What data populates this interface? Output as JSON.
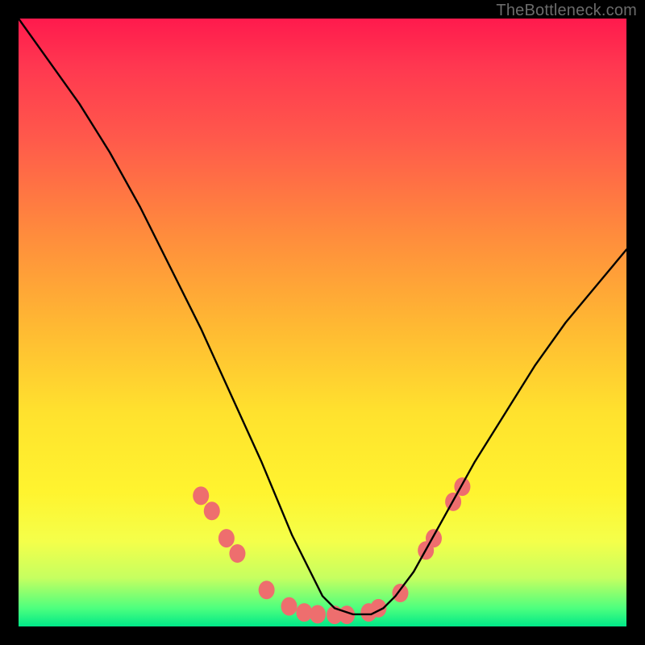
{
  "attribution": "TheBottleneck.com",
  "chart_data": {
    "type": "line",
    "title": "",
    "xlabel": "",
    "ylabel": "",
    "xlim": [
      0,
      100
    ],
    "ylim": [
      0,
      100
    ],
    "series": [
      {
        "name": "curve",
        "x": [
          0,
          5,
          10,
          15,
          20,
          25,
          30,
          35,
          40,
          45,
          48,
          50,
          52,
          55,
          58,
          60,
          62,
          65,
          70,
          75,
          80,
          85,
          90,
          95,
          100
        ],
        "y": [
          100,
          93,
          86,
          78,
          69,
          59,
          49,
          38,
          27,
          15,
          9,
          5,
          3,
          2,
          2,
          3,
          5,
          9,
          18,
          27,
          35,
          43,
          50,
          56,
          62
        ]
      }
    ],
    "markers": [
      {
        "x": 30.0,
        "y": 21.5
      },
      {
        "x": 31.8,
        "y": 19.0
      },
      {
        "x": 34.2,
        "y": 14.5
      },
      {
        "x": 36.0,
        "y": 12.0
      },
      {
        "x": 40.8,
        "y": 6.0
      },
      {
        "x": 44.5,
        "y": 3.3
      },
      {
        "x": 47.0,
        "y": 2.3
      },
      {
        "x": 49.2,
        "y": 2.0
      },
      {
        "x": 52.0,
        "y": 1.9
      },
      {
        "x": 54.0,
        "y": 1.9
      },
      {
        "x": 57.6,
        "y": 2.3
      },
      {
        "x": 59.2,
        "y": 3.0
      },
      {
        "x": 62.8,
        "y": 5.5
      },
      {
        "x": 67.0,
        "y": 12.5
      },
      {
        "x": 68.3,
        "y": 14.5
      },
      {
        "x": 71.5,
        "y": 20.5
      },
      {
        "x": 73.0,
        "y": 23.0
      }
    ],
    "marker_color": "#ee6e6e",
    "marker_radius_px": 10
  }
}
